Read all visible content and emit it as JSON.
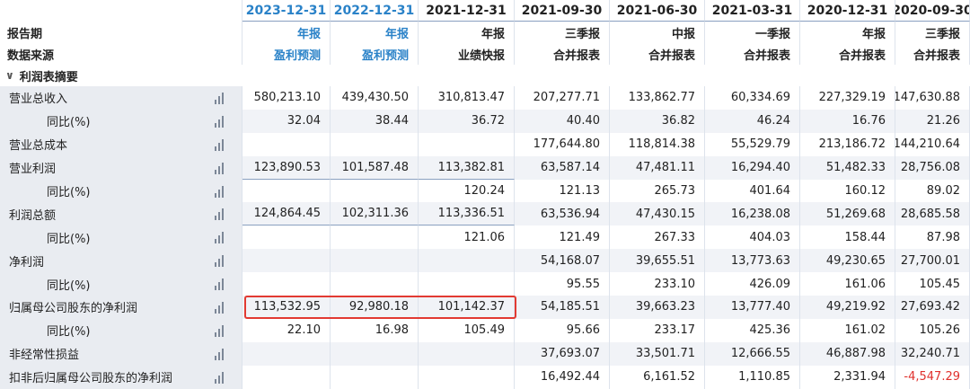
{
  "header": {
    "row_label_1": "报告期",
    "row_label_2": "数据来源",
    "columns": [
      {
        "date": "2023-12-31",
        "type": "年报",
        "source": "盈利预测",
        "accent": true
      },
      {
        "date": "2022-12-31",
        "type": "年报",
        "source": "盈利预测",
        "accent": true
      },
      {
        "date": "2021-12-31",
        "type": "年报",
        "source": "业绩快报",
        "accent": false
      },
      {
        "date": "2021-09-30",
        "type": "三季报",
        "source": "合并报表",
        "accent": false
      },
      {
        "date": "2021-06-30",
        "type": "中报",
        "source": "合并报表",
        "accent": false
      },
      {
        "date": "2021-03-31",
        "type": "一季报",
        "source": "合并报表",
        "accent": false
      },
      {
        "date": "2020-12-31",
        "type": "年报",
        "source": "合并报表",
        "accent": false
      },
      {
        "date": "2020-09-30",
        "type": "三季报",
        "source": "合并报表",
        "accent": false
      }
    ]
  },
  "section": {
    "label": "利润表摘要",
    "chevron": "chevron-down-icon"
  },
  "rows": [
    {
      "label": "营业总收入",
      "sub": false,
      "values": [
        "580,213.10",
        "439,430.50",
        "310,813.47",
        "207,277.71",
        "133,862.77",
        "60,334.69",
        "227,329.19",
        "147,630.88"
      ]
    },
    {
      "label": "同比(%)",
      "sub": true,
      "values": [
        "32.04",
        "38.44",
        "36.72",
        "40.40",
        "36.82",
        "46.24",
        "16.76",
        "21.26"
      ]
    },
    {
      "label": "营业总成本",
      "sub": false,
      "values": [
        "",
        "",
        "",
        "177,644.80",
        "118,814.38",
        "55,529.79",
        "213,186.72",
        "144,210.64"
      ]
    },
    {
      "label": "营业利润",
      "sub": false,
      "values": [
        "123,890.53",
        "101,587.48",
        "113,382.81",
        "63,587.14",
        "47,481.11",
        "16,294.40",
        "51,482.33",
        "28,756.08"
      ]
    },
    {
      "label": "同比(%)",
      "sub": true,
      "values": [
        "",
        "",
        "120.24",
        "121.13",
        "265.73",
        "401.64",
        "160.12",
        "89.02"
      ]
    },
    {
      "label": "利润总额",
      "sub": false,
      "values": [
        "124,864.45",
        "102,311.36",
        "113,336.51",
        "63,536.94",
        "47,430.15",
        "16,238.08",
        "51,269.68",
        "28,685.58"
      ]
    },
    {
      "label": "同比(%)",
      "sub": true,
      "values": [
        "",
        "",
        "121.06",
        "121.49",
        "267.33",
        "404.03",
        "158.44",
        "87.98"
      ]
    },
    {
      "label": "净利润",
      "sub": false,
      "values": [
        "",
        "",
        "",
        "54,168.07",
        "39,655.51",
        "13,773.63",
        "49,230.65",
        "27,700.01"
      ]
    },
    {
      "label": "同比(%)",
      "sub": true,
      "values": [
        "",
        "",
        "",
        "95.55",
        "233.10",
        "426.09",
        "161.06",
        "105.45"
      ]
    },
    {
      "label": "归属母公司股东的净利润",
      "sub": false,
      "values": [
        "113,532.95",
        "92,980.18",
        "101,142.37",
        "54,185.51",
        "39,663.23",
        "13,777.40",
        "49,219.92",
        "27,693.42"
      ]
    },
    {
      "label": "同比(%)",
      "sub": true,
      "values": [
        "22.10",
        "16.98",
        "105.49",
        "95.66",
        "233.17",
        "425.36",
        "161.02",
        "105.26"
      ]
    },
    {
      "label": "非经常性损益",
      "sub": false,
      "values": [
        "",
        "",
        "",
        "37,693.07",
        "33,501.71",
        "12,666.55",
        "46,887.98",
        "32,240.71"
      ]
    },
    {
      "label": "扣非后归属母公司股东的净利润",
      "sub": false,
      "values": [
        "",
        "",
        "",
        "16,492.44",
        "6,161.52",
        "1,110.85",
        "2,331.94",
        "-4,547.29"
      ]
    }
  ],
  "colors": {
    "accent": "#2a82c8",
    "negative": "#e0312d",
    "highlight": "#e23a32"
  }
}
